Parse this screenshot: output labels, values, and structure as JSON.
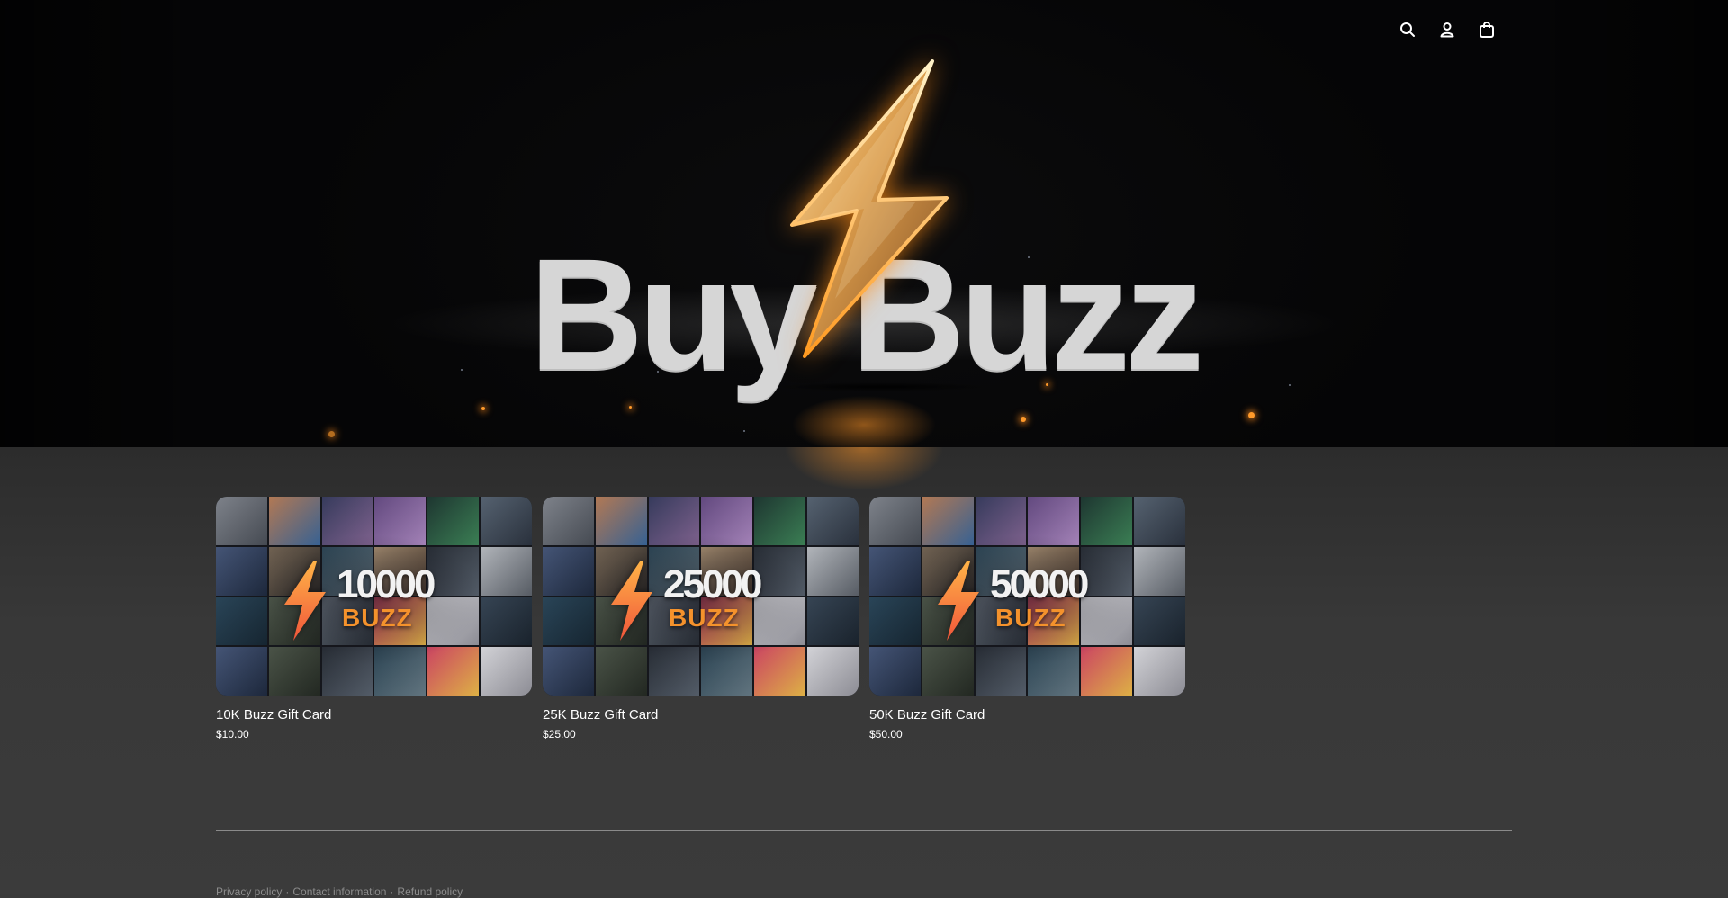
{
  "header": {
    "icons": [
      "search-icon",
      "account-icon",
      "cart-icon"
    ]
  },
  "hero": {
    "title": "Buy Buzz"
  },
  "products": [
    {
      "title": "10K Buzz Gift Card",
      "price": "$10.00",
      "badge_amount": "10000",
      "badge_unit": "BUZZ"
    },
    {
      "title": "25K Buzz Gift Card",
      "price": "$25.00",
      "badge_amount": "25000",
      "badge_unit": "BUZZ"
    },
    {
      "title": "50K Buzz Gift Card",
      "price": "$50.00",
      "badge_amount": "50000",
      "badge_unit": "BUZZ"
    }
  ],
  "footer": {
    "links": [
      "Privacy policy",
      "Contact information",
      "Refund policy"
    ],
    "separator": "·"
  },
  "colors": {
    "accent": "#f4922c",
    "background": "#3a3a3a",
    "hero_background": "#050506"
  }
}
